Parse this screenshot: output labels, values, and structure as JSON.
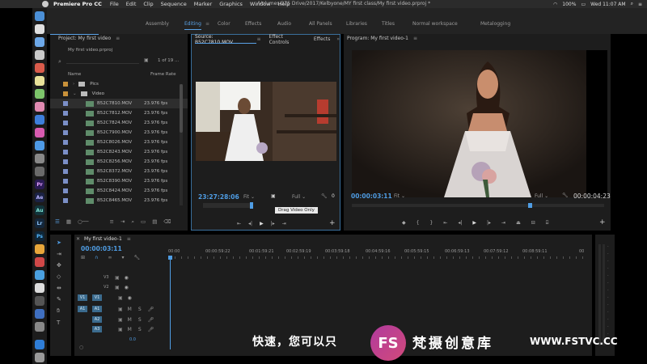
{
  "menubar": {
    "app": "Premiere Pro CC",
    "items": [
      "File",
      "Edit",
      "Clip",
      "Sequence",
      "Marker",
      "Graphics",
      "Window",
      "Help"
    ],
    "path": "/Volumes/375 Drive/2017/Kelbyone/MY first class/My first video.prproj *",
    "battery": "100%",
    "datetime": "Wed 11:07 AM"
  },
  "workspaces": [
    "Assembly",
    "Editing",
    "Color",
    "Effects",
    "Audio",
    "All Panels",
    "Libraries",
    "Titles",
    "Normal workspace",
    "Metalogging"
  ],
  "workspace_active": "Editing",
  "project": {
    "title": "Project: My first video",
    "file": "My first video.prproj",
    "count": "1 of 19 ...",
    "col_name": "Name",
    "col_rate": "Frame Rate",
    "folders": [
      "Pics",
      "Video"
    ],
    "clips": [
      {
        "name": "B52C7810.MOV",
        "fps": "23.976 fps"
      },
      {
        "name": "B52C7812.MOV",
        "fps": "23.976 fps"
      },
      {
        "name": "B52C7824.MOV",
        "fps": "23.976 fps"
      },
      {
        "name": "B52C7900.MOV",
        "fps": "23.976 fps"
      },
      {
        "name": "B52C8026.MOV",
        "fps": "23.976 fps"
      },
      {
        "name": "B52C8243.MOV",
        "fps": "23.976 fps"
      },
      {
        "name": "B52C8256.MOV",
        "fps": "23.976 fps"
      },
      {
        "name": "B52C8372.MOV",
        "fps": "23.976 fps"
      },
      {
        "name": "B52C8390.MOV",
        "fps": "23.976 fps"
      },
      {
        "name": "B52C8424.MOV",
        "fps": "23.976 fps"
      },
      {
        "name": "B52C8465.MOV",
        "fps": "23.976 fps"
      }
    ]
  },
  "source": {
    "tab": "Source: B52C7810.MOV",
    "tab2": "Effect Controls",
    "tab3": "Effects",
    "timecode": "23:27:28:06",
    "fit": "Fit",
    "full": "Full",
    "tooltip": "Drag Video Only",
    "count": "0"
  },
  "program": {
    "tab": "Program: My first video-1",
    "timecode": "00:00:03:11",
    "fit": "Fit",
    "full": "Full",
    "duration": "00:00:04:23"
  },
  "timeline": {
    "tab": "My first video-1",
    "timecode": "00:00:03:11",
    "ruler": [
      "00:00",
      "00:00:59:22",
      "00:01:59:21",
      "00:02:59:19",
      "00:03:59:18",
      "00:04:59:16",
      "00:05:59:15",
      "00:06:59:13",
      "00:07:59:12",
      "00:08:59:11",
      "00"
    ],
    "video_tracks": [
      "V3",
      "V2",
      "V1"
    ],
    "audio_tracks": [
      "A1",
      "A2",
      "A3"
    ],
    "src_v": "V1",
    "src_a": "A1",
    "volume": "0.0"
  },
  "overlay": {
    "subtitle": "快速，您可以只",
    "brand_cn": "梵摄创意库",
    "brand_url": "WWW.FSTVC.CC",
    "logo": "FS"
  }
}
